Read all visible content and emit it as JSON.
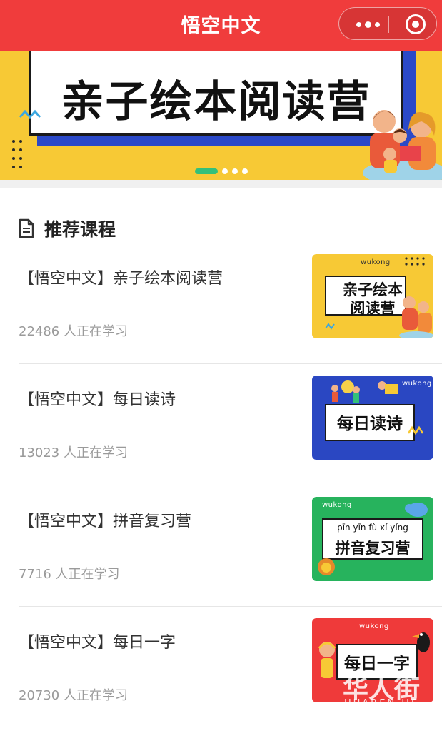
{
  "app": {
    "title": "悟空中文"
  },
  "banner": {
    "title": "亲子绘本阅读营",
    "slides": 4,
    "active_slide": 1
  },
  "section": {
    "title": "推荐课程",
    "icon": "document-icon"
  },
  "courses": [
    {
      "title": "【悟空中文】亲子绘本阅读营",
      "count": "22486 人正在学习",
      "thumb": {
        "brand": "wukong",
        "lines": [
          "亲子绘本",
          "阅读营"
        ],
        "bg": "#f7c935"
      }
    },
    {
      "title": "【悟空中文】每日读诗",
      "count": "13023 人正在学习",
      "thumb": {
        "brand": "wukong",
        "lines": [
          "每日读诗"
        ],
        "bg": "#2a47c2"
      }
    },
    {
      "title": "【悟空中文】拼音复习营",
      "count": "7716 人正在学习",
      "thumb": {
        "brand": "wukong",
        "pinyin": "pīn yīn fù xí yíng",
        "lines": [
          "拼音复习营"
        ],
        "bg": "#27b35d"
      }
    },
    {
      "title": "【悟空中文】每日一字",
      "count": "20730 人正在学习",
      "thumb": {
        "brand": "wukong",
        "lines": [
          "每日一字"
        ],
        "bg": "#ef3a3a"
      }
    }
  ],
  "watermark": {
    "main": "华人街",
    "sub": "HUAREN JIE"
  },
  "colors": {
    "header": "#f03c3c",
    "banner": "#f7c935",
    "indicator_active": "#34c07a"
  }
}
